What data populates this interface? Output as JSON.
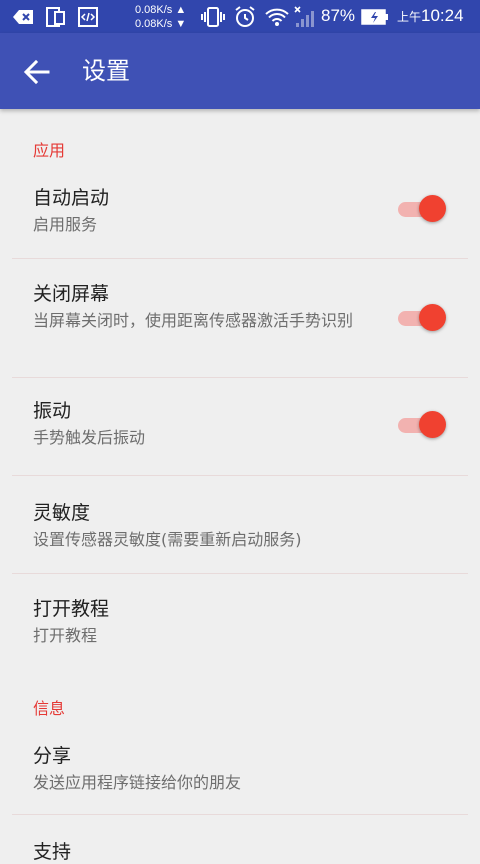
{
  "status_bar": {
    "speed_up": "0.08K/s ▲",
    "speed_down": "0.08K/s ▼",
    "battery_percent": "87%",
    "time_period": "上午",
    "time": "10:24",
    "icons": [
      "usb-debug-icon",
      "phone-screen-icon",
      "code-icon",
      "vibrate-icon",
      "alarm-icon",
      "wifi-icon",
      "signal-icon",
      "battery-icon"
    ]
  },
  "app_bar": {
    "title": "设置",
    "back_icon": "arrow-left-icon"
  },
  "sections": {
    "app": {
      "header": "应用"
    },
    "info": {
      "header": "信息"
    }
  },
  "items": {
    "auto_start": {
      "title": "自动启动",
      "subtitle": "启用服务",
      "toggle_on": true
    },
    "screen_off": {
      "title": "关闭屏幕",
      "subtitle": "当屏幕关闭时，使用距离传感器激活手势识别",
      "toggle_on": true
    },
    "vibrate": {
      "title": "振动",
      "subtitle": "手势触发后振动",
      "toggle_on": true
    },
    "sensitivity": {
      "title": "灵敏度",
      "subtitle": "设置传感器灵敏度(需要重新启动服务)"
    },
    "tutorial": {
      "title": "打开教程",
      "subtitle": "打开教程"
    },
    "share": {
      "title": "分享",
      "subtitle": "发送应用程序链接给你的朋友"
    },
    "support": {
      "title": "支持"
    }
  },
  "colors": {
    "status_bar": "#3146ad",
    "app_bar": "#3f51b5",
    "accent": "#f04130",
    "section_header": "#e53935",
    "background": "#efefef"
  }
}
